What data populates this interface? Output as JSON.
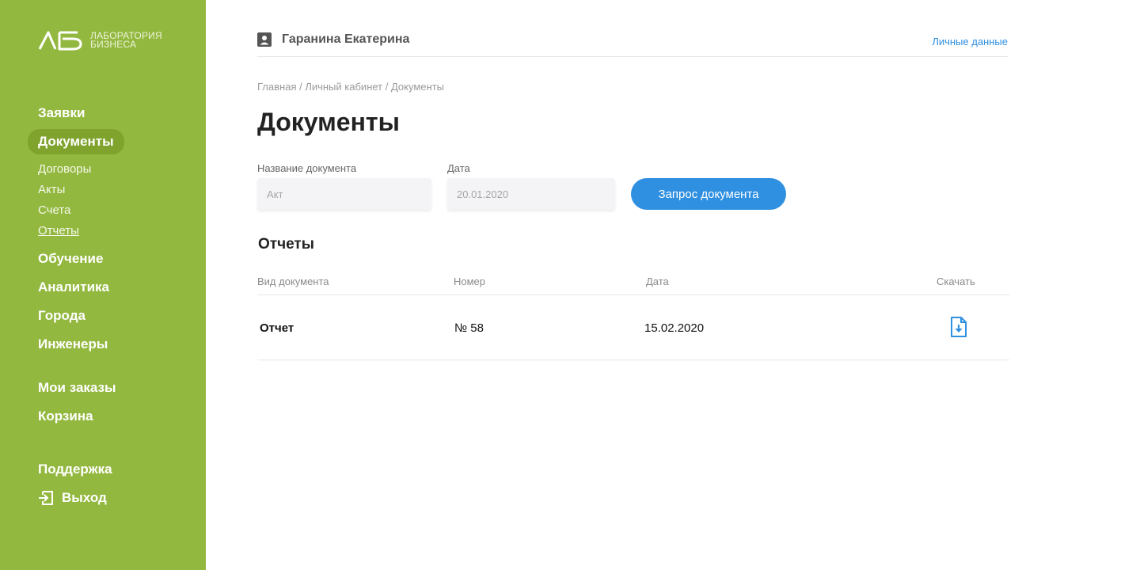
{
  "logo": {
    "line1": "ЛАБОРАТОРИЯ",
    "line2": "БИЗНЕСА",
    "icon": "lb-logo-icon"
  },
  "sidebar": {
    "items": [
      {
        "label": "Заявки"
      },
      {
        "label": "Документы",
        "active": true
      },
      {
        "label": "Обучение"
      },
      {
        "label": "Аналитика"
      },
      {
        "label": "Города"
      },
      {
        "label": "Инженеры"
      },
      {
        "label": "Мои заказы"
      },
      {
        "label": "Корзина"
      },
      {
        "label": "Поддержка"
      },
      {
        "label": "Выход",
        "icon": "logout-icon"
      }
    ],
    "subitems": [
      {
        "label": "Договоры"
      },
      {
        "label": "Акты"
      },
      {
        "label": "Счета"
      },
      {
        "label": "Отчеты",
        "selected": true
      }
    ]
  },
  "header": {
    "user_name": "Гаранина Екатерина",
    "personal_link": "Личные данные",
    "user_icon": "user-card-icon"
  },
  "breadcrumb": "Главная / Личный кабинет / Документы",
  "page_title": "Документы",
  "filters": {
    "name_label": "Название документа",
    "name_placeholder": "Акт",
    "date_label": "Дата",
    "date_placeholder": "20.01.2020",
    "request_button": "Запрос документа"
  },
  "section_title": "Отчеты",
  "table": {
    "headers": [
      "Вид документа",
      "Номер",
      "Дата",
      "Скачать"
    ],
    "rows": [
      {
        "type": "Отчет",
        "number": "№ 58",
        "date": "15.02.2020",
        "download_icon": "file-download-icon"
      }
    ]
  },
  "colors": {
    "sidebar": "#93b83f",
    "active": "#7fa32d",
    "accent": "#2f8fe0"
  }
}
